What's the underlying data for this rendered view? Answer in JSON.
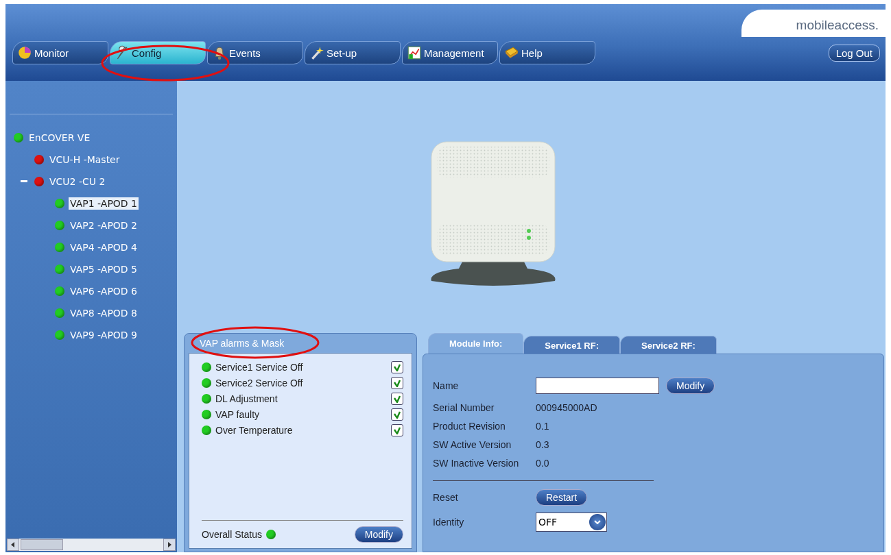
{
  "logo": {
    "text": "mobileaccess."
  },
  "nav_tabs": [
    {
      "label": "Monitor",
      "selected": false
    },
    {
      "label": "Config",
      "selected": true
    },
    {
      "label": "Events",
      "selected": false
    },
    {
      "label": "Set-up",
      "selected": false
    },
    {
      "label": "Management",
      "selected": false
    },
    {
      "label": "Help",
      "selected": false
    }
  ],
  "logout_button": "Log Out",
  "tree": [
    {
      "label": "EnCOVER VE",
      "color": "#22cc22",
      "selected": false,
      "children": [
        {
          "label": "VCU-H -Master",
          "color": "#dd1111",
          "selected": false
        },
        {
          "label": "VCU2 -CU 2",
          "color": "#dd1111",
          "selected": false,
          "expanded": true,
          "children": [
            {
              "label": "VAP1 -APOD 1",
              "color": "#22cc22",
              "selected": true
            },
            {
              "label": "VAP2 -APOD 2",
              "color": "#22cc22",
              "selected": false
            },
            {
              "label": "VAP4 -APOD 4",
              "color": "#22cc22",
              "selected": false
            },
            {
              "label": "VAP5 -APOD 5",
              "color": "#22cc22",
              "selected": false
            },
            {
              "label": "VAP6 -APOD 6",
              "color": "#22cc22",
              "selected": false
            },
            {
              "label": "VAP8 -APOD 8",
              "color": "#22cc22",
              "selected": false
            },
            {
              "label": "VAP9 -APOD 9",
              "color": "#22cc22",
              "selected": false
            }
          ]
        }
      ]
    }
  ],
  "alarms_panel": {
    "title": "VAP alarms & Mask",
    "alarms": [
      {
        "label": "Service1 Service Off",
        "color": "#22cc22",
        "checked": true
      },
      {
        "label": "Service2 Service Off",
        "color": "#22cc22",
        "checked": true
      },
      {
        "label": "DL Adjustment",
        "color": "#22cc22",
        "checked": true
      },
      {
        "label": "VAP faulty",
        "color": "#22cc22",
        "checked": true
      },
      {
        "label": "Over Temperature",
        "color": "#22cc22",
        "checked": true
      }
    ],
    "overall_status": {
      "label": "Overall Status",
      "color": "#22cc22"
    },
    "modify_button": "Modify"
  },
  "info_tabs": [
    {
      "label": "Module Info:",
      "selected": true
    },
    {
      "label": "Service1 RF:",
      "selected": false
    },
    {
      "label": "Service2 RF:",
      "selected": false
    }
  ],
  "module_info": {
    "name_label": "Name",
    "modify_button": "Modify",
    "fields": [
      {
        "label": "Serial Number",
        "value": "000945000AD"
      },
      {
        "label": "Product Revision",
        "value": "0.1"
      },
      {
        "label": "SW Active Version",
        "value": "0.3"
      },
      {
        "label": "SW Inactive Version",
        "value": "0.0"
      }
    ],
    "reset_label": "Reset",
    "restart_button": "Restart",
    "identity_label": "Identity",
    "identity_value": "OFF"
  }
}
